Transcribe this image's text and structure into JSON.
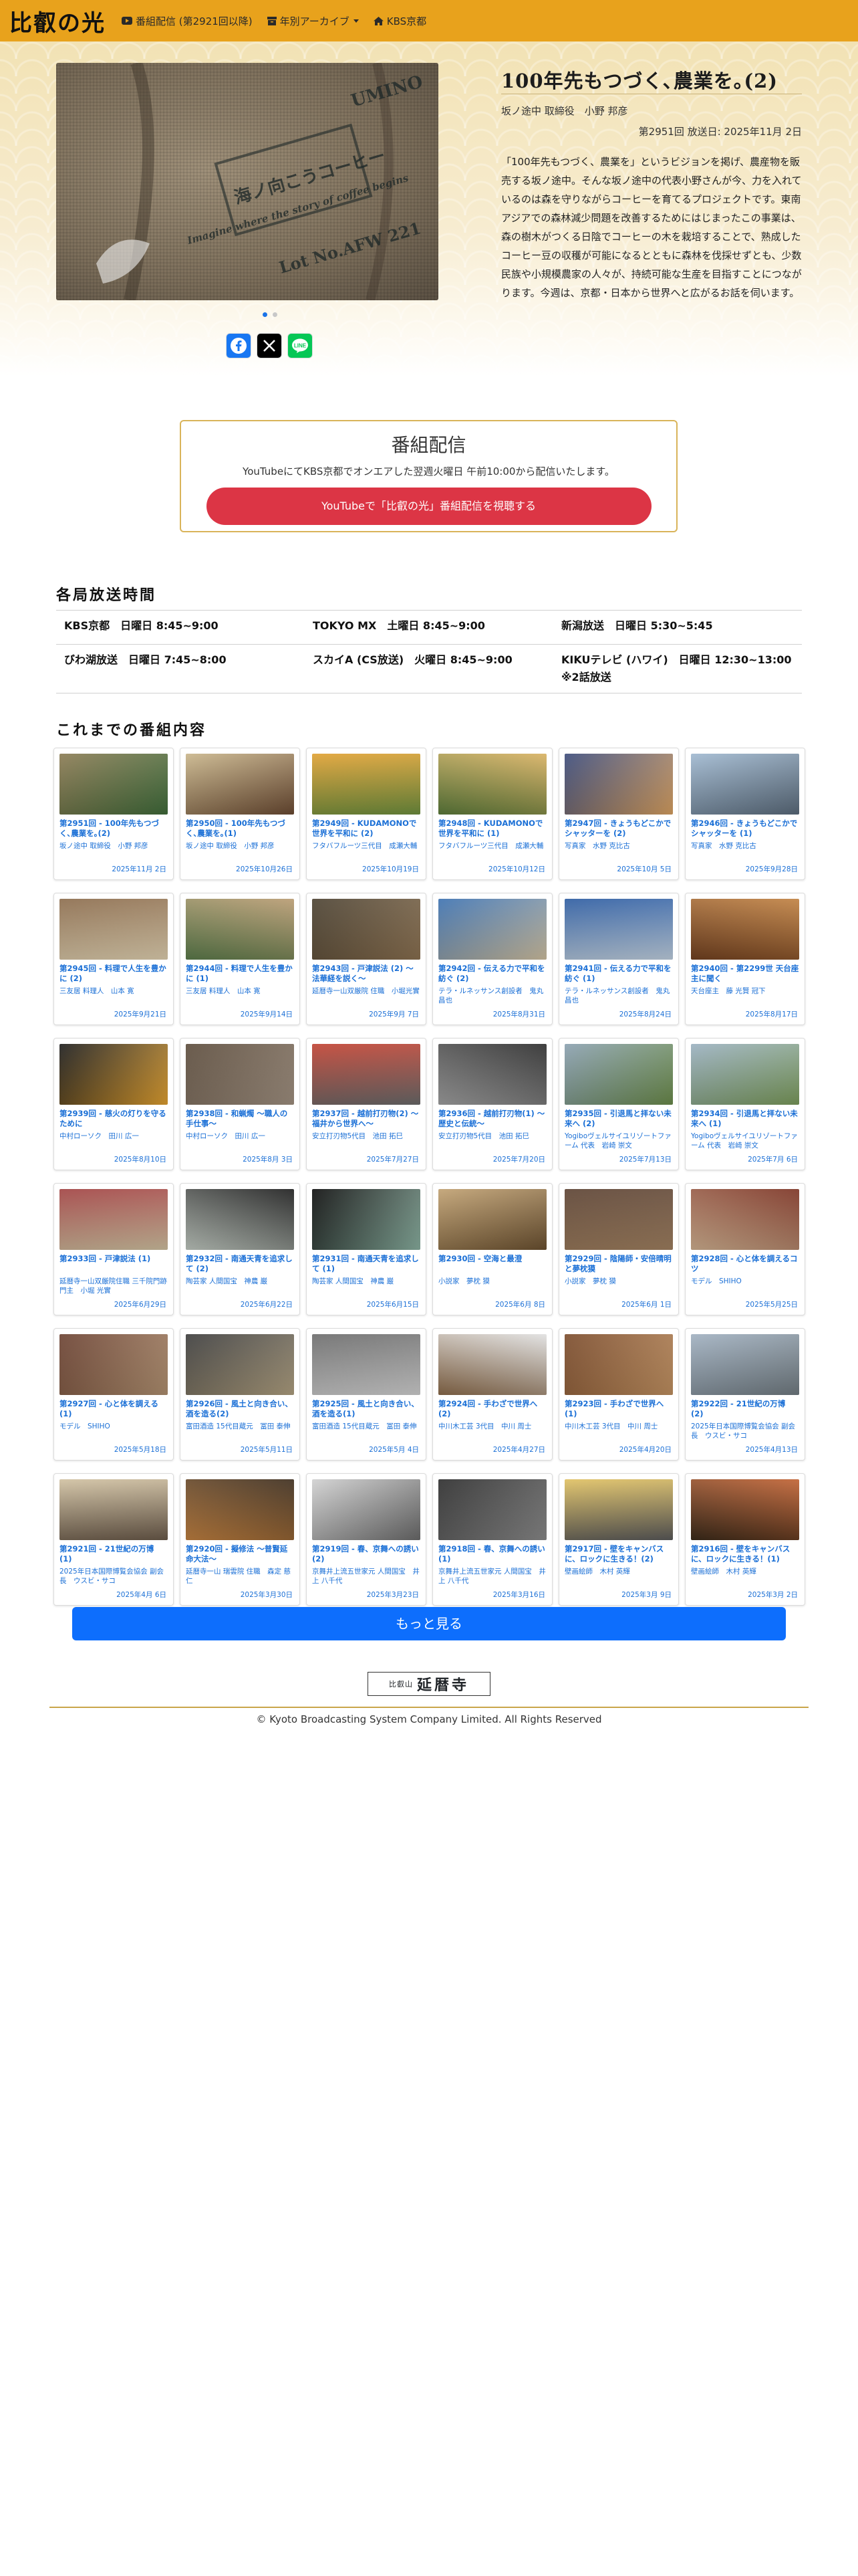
{
  "navbar": {
    "brand": "比叡の光",
    "items": [
      {
        "label": "番組配信 (第2921回以降)",
        "icon": "youtube-icon"
      },
      {
        "label": "年別アーカイブ",
        "icon": "archive-icon"
      },
      {
        "label": "KBS京都",
        "icon": "home-icon"
      }
    ]
  },
  "hero": {
    "title": "100年先もつづく､農業を｡(2)",
    "guest": "坂ノ途中 取締役　小野 邦彦",
    "meta": "第2951回 放送日: 2025年11月 2日",
    "description": "「100年先もつづく、農業を」というビジョンを掲げ、農産物を販売する坂ノ途中。そんな坂ノ途中の代表小野さんが今、力を入れているのは森を守りながらコーヒーを育てるプロジェクトです。東南アジアでの森林減少問題を改善するためにはじまったこの事業は、森の樹木がつくる日陰でコーヒーの木を栽培することで、熟成したコーヒー豆の収穫が可能になるとともに森林を伐採せずとも、少数民族や小規模農家の人々が、持続可能な生産を目指すことにつながります。今週は、京都・日本から世界へと広がるお話を伺います。",
    "image_text": [
      "UMINO",
      "海ノ向こうコーヒー",
      "Imagine where the story of coffee begins",
      "Lot No.AFW 221"
    ],
    "dots": 2,
    "share": [
      "facebook-icon",
      "x-icon",
      "line-icon"
    ]
  },
  "broadcast": {
    "title": "番組配信",
    "subtitle": "YouTubeにてKBS京都でオンエアした翌週火曜日 午前10:00から配信いたします。",
    "button": "YouTubeで「比叡の光」番組配信を視聴する"
  },
  "schedule": {
    "title": "各局放送時間",
    "rows": [
      [
        "KBS京都　日曜日 8:45~9:00",
        "TOKYO MX　土曜日 8:45~9:00",
        "新潟放送　日曜日 5:30~5:45"
      ],
      [
        "びわ湖放送　日曜日 7:45~8:00",
        "スカイA (CS放送)　火曜日 8:45~9:00",
        "KIKUテレビ (ハワイ)　日曜日 12:30~13:00 ※2話放送"
      ]
    ]
  },
  "episodes_title": "これまでの番組内容",
  "episodes": [
    {
      "title": "第2951回 - 100年先もつづく､農業を｡(2)",
      "guest": "坂ノ途中 取締役　小野 邦彦",
      "date": "2025年11月 2日",
      "colors": [
        "#8a7a52",
        "#3f6b3a"
      ]
    },
    {
      "title": "第2950回 - 100年先もつづく､農業を｡(1)",
      "guest": "坂ノ途中 取締役　小野 邦彦",
      "date": "2025年10月26日",
      "colors": [
        "#c9b58a",
        "#6a4a32"
      ]
    },
    {
      "title": "第2949回 - KUDAMONOで世界を平和に (2)",
      "guest": "フタバフルーツ三代目　成瀬大輔",
      "date": "2025年10月19日",
      "colors": [
        "#e0a030",
        "#6e8f3e"
      ]
    },
    {
      "title": "第2948回 - KUDAMONOで世界を平和に (1)",
      "guest": "フタバフルーツ三代目　成瀬大輔",
      "date": "2025年10月12日",
      "colors": [
        "#d8b060",
        "#5b7a3a"
      ]
    },
    {
      "title": "第2947回 - きょうもどこかでシャッターを (2)",
      "guest": "写真家　水野 克比古",
      "date": "2025年10月 5日",
      "colors": [
        "#3a4a7a",
        "#d8a060"
      ]
    },
    {
      "title": "第2946回 - きょうもどこかでシャッターを (1)",
      "guest": "写真家　水野 克比古",
      "date": "2025年9月28日",
      "colors": [
        "#9fb8d0",
        "#5a6a7a"
      ]
    },
    {
      "title": "第2945回 - 料理で人生を豊かに (2)",
      "guest": "三友居 料理人　山本 寛",
      "date": "2025年9月21日",
      "colors": [
        "#8a6a4a",
        "#e0d0b0"
      ]
    },
    {
      "title": "第2944回 - 料理で人生を豊かに (1)",
      "guest": "三友居 料理人　山本 寛",
      "date": "2025年9月14日",
      "colors": [
        "#b89a70",
        "#5a7a4a"
      ]
    },
    {
      "title": "第2943回 - 戸津説法 (2) 〜法華経を説く〜",
      "guest": "延暦寺一山双厳院 住職　小堀光實",
      "date": "2025年9月 7日",
      "colors": [
        "#4a4030",
        "#8a7050"
      ]
    },
    {
      "title": "第2942回 - 伝える力で平和を紡ぐ (2)",
      "guest": "テラ・ルネッサンス創設者　鬼丸 昌也",
      "date": "2025年8月31日",
      "colors": [
        "#3a70b0",
        "#d0c0a0"
      ]
    },
    {
      "title": "第2941回 - 伝える力で平和を紡ぐ (1)",
      "guest": "テラ・ルネッサンス創設者　鬼丸 昌也",
      "date": "2025年8月24日",
      "colors": [
        "#2a5aa0",
        "#c0d0e0"
      ]
    },
    {
      "title": "第2940回 - 第2299世 天台座主に聞く",
      "guest": "天台座主　藤 光賢 冠下",
      "date": "2025年8月17日",
      "colors": [
        "#c08040",
        "#704020"
      ]
    },
    {
      "title": "第2939回 - 慈火の灯りを守るために",
      "guest": "中村ローソク　田川 広一",
      "date": "2025年8月10日",
      "colors": [
        "#1a1a1a",
        "#e0a030"
      ]
    },
    {
      "title": "第2938回 - 和蝋燭 〜職人の手仕事〜",
      "guest": "中村ローソク　田川 広一",
      "date": "2025年8月 3日",
      "colors": [
        "#5a4a3a",
        "#a09080"
      ]
    },
    {
      "title": "第2937回 - 越前打刃物(2) 〜福井から世界へ〜",
      "guest": "安立打刃物5代目　池田 拓巳",
      "date": "2025年7月27日",
      "colors": [
        "#c04030",
        "#6a6a6a"
      ]
    },
    {
      "title": "第2936回 - 越前打刃物(1) 〜歴史と伝統〜",
      "guest": "安立打刃物5代目　池田 拓巳",
      "date": "2025年7月20日",
      "colors": [
        "#2a2a2a",
        "#a0a0a0"
      ]
    },
    {
      "title": "第2935回 - 引退馬と拝ない未来へ (2)",
      "guest": "Yogiboヴェルサイユリゾートファーム 代表　岩崎 崇文",
      "date": "2025年7月13日",
      "colors": [
        "#8aa0b0",
        "#6a8a4a"
      ]
    },
    {
      "title": "第2934回 - 引退馬と拝ない未来へ (1)",
      "guest": "Yogiboヴェルサイユリゾートファーム 代表　岩崎 崇文",
      "date": "2025年7月 6日",
      "colors": [
        "#9ab0c0",
        "#7a9a5a"
      ]
    },
    {
      "title": "第2933回 - 戸津説法 (1)",
      "guest": "延暦寺一山双厳院住職 三千院門跡門主　小堀 光實",
      "date": "2025年6月29日",
      "colors": [
        "#a04040",
        "#d0c0a0"
      ]
    },
    {
      "title": "第2932回 - 南通天青を追求して (2)",
      "guest": "陶芸家 人間国宝　神農 巌",
      "date": "2025年6月22日",
      "colors": [
        "#1a1a1a",
        "#c0c8c0"
      ]
    },
    {
      "title": "第2931回 - 南通天青を追求して (1)",
      "guest": "陶芸家 人間国宝　神農 巌",
      "date": "2025年6月15日",
      "colors": [
        "#0a0a0a",
        "#8ab0a0"
      ]
    },
    {
      "title": "第2930回 - 空海と最澄",
      "guest": "小説家　夢枕 獏",
      "date": "2025年6月 8日",
      "colors": [
        "#c0a070",
        "#6a5030"
      ]
    },
    {
      "title": "第2929回 - 陰陽師・安倍晴明と夢枕獏",
      "guest": "小説家　夢枕 獏",
      "date": "2025年6月 1日",
      "colors": [
        "#5a4030",
        "#a08060"
      ]
    },
    {
      "title": "第2928回 - 心と体を調えるコツ",
      "guest": "モデル　SHIHO",
      "date": "2025年5月25日",
      "colors": [
        "#7a3020",
        "#d0b090"
      ]
    },
    {
      "title": "第2927回 - 心と体を調える (1)",
      "guest": "モデル　SHIHO",
      "date": "2025年5月18日",
      "colors": [
        "#6a4030",
        "#b09070"
      ]
    },
    {
      "title": "第2926回 - 風土と向き合い、酒を造る(2)",
      "guest": "富田酒造 15代目蔵元　冨田 泰伸",
      "date": "2025年5月11日",
      "colors": [
        "#3a3a3a",
        "#b0a080"
      ]
    },
    {
      "title": "第2925回 - 風土と向き合い、酒を造る(1)",
      "guest": "富田酒造 15代目蔵元　冨田 泰伸",
      "date": "2025年5月 4日",
      "colors": [
        "#6a6a6a",
        "#d0d0d0"
      ]
    },
    {
      "title": "第2924回 - 手わざで世界へ(2)",
      "guest": "中川木工芸 3代目　中川 周士",
      "date": "2025年4月27日",
      "colors": [
        "#e0e0e0",
        "#8a6a4a"
      ]
    },
    {
      "title": "第2923回 - 手わざで世界へ(1)",
      "guest": "中川木工芸 3代目　中川 周士",
      "date": "2025年4月20日",
      "colors": [
        "#7a4a2a",
        "#c09060"
      ]
    },
    {
      "title": "第2922回 - 21世紀の万博 (2)",
      "guest": "2025年日本国際博覧会協会 副会長　ウスビ・サコ",
      "date": "2025年4月13日",
      "colors": [
        "#a0b0c0",
        "#707a80"
      ]
    },
    {
      "title": "第2921回 - 21世紀の万博 (1)",
      "guest": "2025年日本国際博覧会協会 副会長　ウスビ・サコ",
      "date": "2025年4月 6日",
      "colors": [
        "#d0c0a0",
        "#6a5a4a"
      ]
    },
    {
      "title": "第2920回 - 擬修法 〜普賢延命大法〜",
      "guest": "延暦寺一山 瑞雲院 住職　森定 慈仁",
      "date": "2025年3月30日",
      "colors": [
        "#3a2a1a",
        "#c08040"
      ]
    },
    {
      "title": "第2919回 - 春、京舞への誘い(2)",
      "guest": "京舞井上流五世家元 人間国宝　井上 八千代",
      "date": "2025年3月23日",
      "colors": [
        "#d0d0d0",
        "#6a6a6a"
      ]
    },
    {
      "title": "第2918回 - 春、京舞への誘い(1)",
      "guest": "京舞井上流五世家元 人間国宝　井上 八千代",
      "date": "2025年3月16日",
      "colors": [
        "#2a2a2a",
        "#8a8a8a"
      ]
    },
    {
      "title": "第2917回 - 壁をキャンバスに、ロックに生きる！(2)",
      "guest": "壁画絵師　木村 英輝",
      "date": "2025年3月 9日",
      "colors": [
        "#e0c060",
        "#5a5a5a"
      ]
    },
    {
      "title": "第2916回 - 壁をキャンバスに、ロックに生きる！(1)",
      "guest": "壁画絵師　木村 英輝",
      "date": "2025年3月 2日",
      "colors": [
        "#c06030",
        "#3a2a1a"
      ]
    }
  ],
  "more_button": "もっと見る",
  "footer": {
    "logo_small": "比叡山",
    "logo_big": "延暦寺",
    "copyright": "© Kyoto Broadcasting System Company Limited. All Rights Reserved"
  }
}
